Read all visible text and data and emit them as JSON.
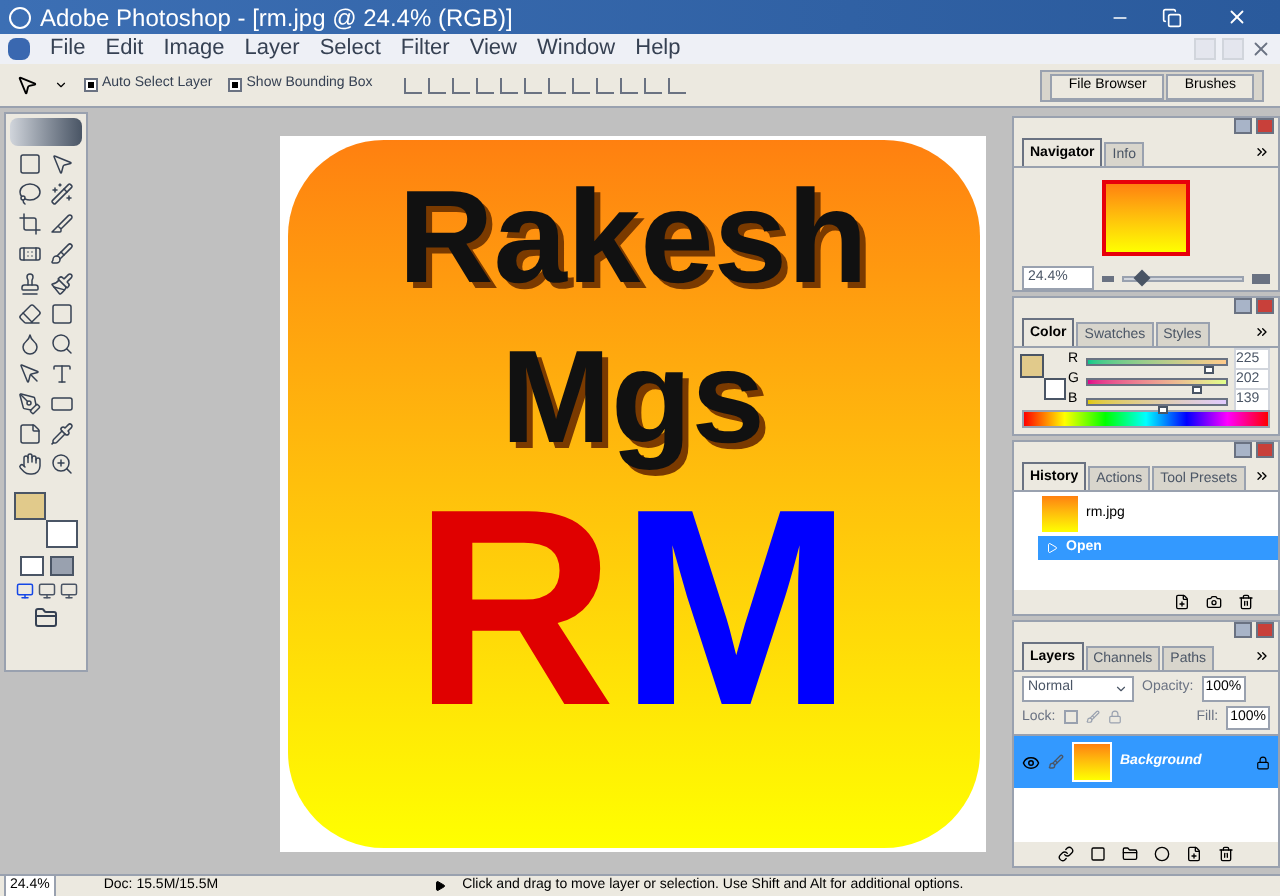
{
  "window": {
    "title": "Adobe Photoshop - [rm.jpg @ 24.4% (RGB)]"
  },
  "menu": [
    "File",
    "Edit",
    "Image",
    "Layer",
    "Select",
    "Filter",
    "View",
    "Window",
    "Help"
  ],
  "options": {
    "checkboxes": [
      {
        "label": "Auto Select Layer",
        "checked": true
      },
      {
        "label": "Show Bounding Box",
        "checked": true
      }
    ],
    "well_tabs": [
      {
        "label": "File Browser",
        "selected": false
      },
      {
        "label": "Brushes",
        "selected": false
      }
    ]
  },
  "document": {
    "lines": [
      "Rakesh",
      "Mgs"
    ],
    "logo_letters": [
      "R",
      "M"
    ]
  },
  "navigator": {
    "tabs": [
      {
        "label": "Navigator",
        "selected": true
      },
      {
        "label": "Info",
        "selected": false
      }
    ],
    "zoom": "24.4%",
    "level": 0.1
  },
  "color": {
    "tabs": [
      {
        "label": "Color",
        "selected": true
      },
      {
        "label": "Swatches",
        "selected": false
      },
      {
        "label": "Styles",
        "selected": false
      }
    ],
    "channels": [
      {
        "name": "R",
        "value": "225",
        "level": 0.88
      },
      {
        "name": "G",
        "value": "202",
        "level": 0.79
      },
      {
        "name": "B",
        "value": "139",
        "level": 0.55
      }
    ]
  },
  "history": {
    "tabs": [
      {
        "label": "History",
        "selected": true
      },
      {
        "label": "Actions",
        "selected": false
      },
      {
        "label": "Tool Presets",
        "selected": false
      }
    ],
    "items": [
      {
        "label": "rm.jpg",
        "kind": "snapshot",
        "selected": false
      },
      {
        "label": "Open",
        "kind": "state",
        "selected": true
      }
    ]
  },
  "layers": {
    "tabs": [
      {
        "label": "Layers",
        "selected": true
      },
      {
        "label": "Channels",
        "selected": false
      },
      {
        "label": "Paths",
        "selected": false
      }
    ],
    "blend_mode": "Normal",
    "opacity_label": "Opacity:",
    "opacity": "100%",
    "lock_label": "Lock:",
    "fill_label": "Fill:",
    "fill": "100%",
    "items": [
      {
        "name": "Background",
        "selected": true,
        "visible": true,
        "locked": true
      }
    ]
  },
  "status_bar": {
    "zoom": "24.4%",
    "doc": "Doc: 15.5M/15.5M",
    "hint": "Click and drag to move layer or selection.  Use Shift and Alt for additional options."
  }
}
